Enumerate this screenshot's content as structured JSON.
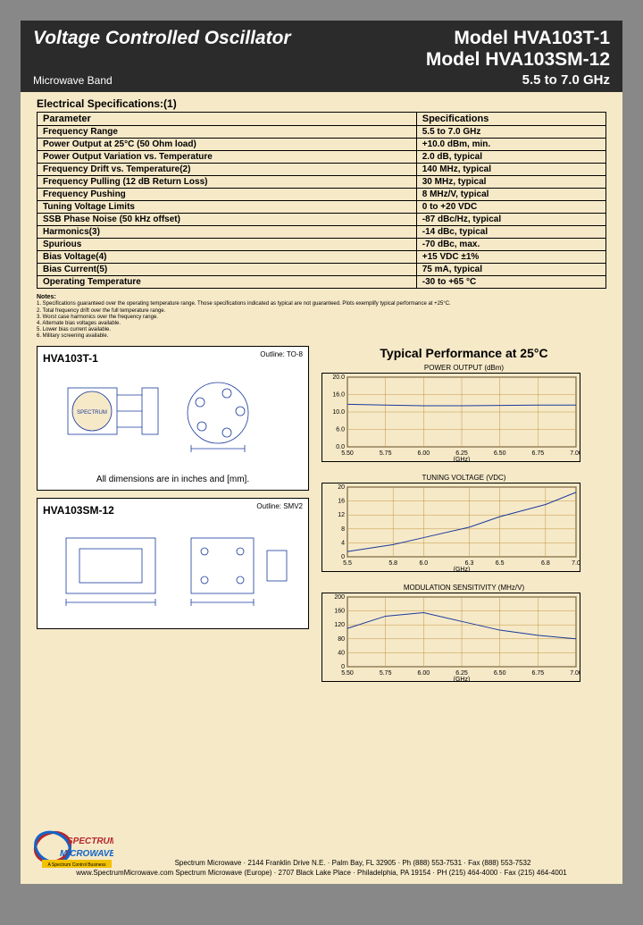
{
  "header": {
    "title": "Voltage Controlled Oscillator",
    "model1": "Model HVA103T-1",
    "model2": "Model HVA103SM-12",
    "band": "Microwave Band",
    "freq": "5.5 to 7.0 GHz"
  },
  "section_elec": "Electrical Specifications:(1)",
  "spec_headers": {
    "param": "Parameter",
    "spec": "Specifications"
  },
  "specs": [
    {
      "p": "Frequency Range",
      "s": "5.5 to 7.0 GHz"
    },
    {
      "p": "Power Output at 25°C (50 Ohm load)",
      "s": "+10.0 dBm, min."
    },
    {
      "p": "Power Output Variation vs. Temperature",
      "s": "2.0 dB, typical"
    },
    {
      "p": "Frequency Drift vs. Temperature(2)",
      "s": "140 MHz, typical"
    },
    {
      "p": "Frequency Pulling (12 dB Return Loss)",
      "s": "30 MHz, typical"
    },
    {
      "p": "Frequency Pushing",
      "s": "8 MHz/V, typical"
    },
    {
      "p": "Tuning Voltage Limits",
      "s": "0 to +20 VDC"
    },
    {
      "p": "SSB Phase Noise (50 kHz offset)",
      "s": "-87 dBc/Hz, typical"
    },
    {
      "p": "Harmonics(3)",
      "s": "-14 dBc, typical"
    },
    {
      "p": "Spurious",
      "s": "-70 dBc, max."
    },
    {
      "p": "Bias Voltage(4)",
      "s": "+15 VDC ±1%"
    },
    {
      "p": "Bias Current(5)",
      "s": "75 mA, typical"
    },
    {
      "p": "Operating Temperature",
      "s": "-30 to +65 °C"
    }
  ],
  "notes_title": "Notes:",
  "notes": [
    "1. Specifications guaranteed over the operating temperature range. Those specifications indicated as typical are not guaranteed. Plots exemplify typical performance at +25°C.",
    "2. Total frequency drift over the full temperature range.",
    "3. Worst case harmonics over the frequency range.",
    "4. Alternate bias voltages available.",
    "5. Lower bias current available.",
    "6. Military screening available."
  ],
  "perf_title": "Typical Performance at 25°C",
  "box1": {
    "label": "HVA103T-1",
    "outline": "Outline: TO-8",
    "dim": "All dimensions are in inches and [mm]."
  },
  "box2": {
    "label": "HVA103SM-12",
    "outline": "Outline: SMV2"
  },
  "chart_xlabel": "(GHz)",
  "chart_data": [
    {
      "type": "line",
      "title": "POWER OUTPUT (dBm)",
      "x": [
        5.5,
        5.75,
        6.0,
        6.25,
        6.5,
        6.75,
        7.0
      ],
      "ylim": [
        0.0,
        20.0
      ],
      "yticks": [
        0.0,
        5.0,
        10.0,
        15.0,
        20.0
      ],
      "yticklabels": [
        "0.0",
        "6.0",
        "10.0",
        "16.0",
        "20.0"
      ],
      "values": [
        12.2,
        12.0,
        11.8,
        11.8,
        11.9,
        12.0,
        12.0
      ]
    },
    {
      "type": "line",
      "title": "TUNING VOLTAGE (VDC)",
      "x": [
        5.5,
        5.8,
        6.0,
        6.3,
        6.5,
        6.8,
        7.0
      ],
      "ylim": [
        0.0,
        20.0
      ],
      "yticks": [
        0.0,
        4.0,
        8.0,
        12.0,
        16.0,
        20.0
      ],
      "values": [
        1.5,
        3.5,
        5.5,
        8.5,
        11.5,
        15.0,
        18.5
      ]
    },
    {
      "type": "line",
      "title": "MODULATION SENSITIVITY (MHz/V)",
      "x": [
        5.5,
        5.75,
        6.0,
        6.25,
        6.5,
        6.75,
        7.0
      ],
      "ylim": [
        0,
        200
      ],
      "yticks": [
        0,
        40,
        80,
        120,
        160,
        200
      ],
      "values": [
        110,
        145,
        155,
        130,
        105,
        90,
        80
      ]
    }
  ],
  "footer": {
    "l1": "Spectrum Microwave · 2144 Franklin Drive N.E. · Palm Bay, FL 32905 · Ph (888) 553-7531 · Fax (888) 553-7532",
    "l2": "www.SpectrumMicrowave.com Spectrum Microwave (Europe) · 2707 Black Lake Place · Philadelphia, PA 19154 · PH (215) 464-4000 · Fax (215) 464-4001"
  },
  "logo": {
    "t1": "SPECTRUM",
    "t2": "MICROWAVE",
    "tag": "A Spectrum Control Business"
  }
}
